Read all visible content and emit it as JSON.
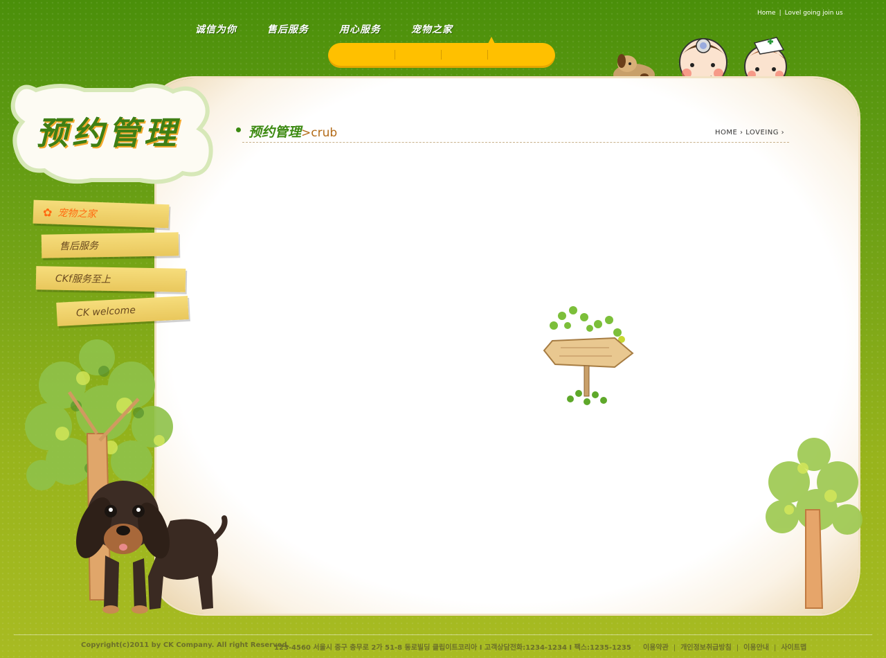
{
  "top_links": {
    "home": "Home",
    "separator": "|",
    "join": "Lovel going join us"
  },
  "top_nav": [
    "诚信为你",
    "售后服务",
    "用心服务",
    "宠物之家"
  ],
  "page": {
    "title": "预约管理",
    "heading": "预约管理",
    "heading_sub": ">crub",
    "breadcrumb": [
      "HOME",
      "LOVEING"
    ]
  },
  "side_nav": [
    {
      "label": "宠物之家",
      "active": true
    },
    {
      "label": "售后服务",
      "active": false
    },
    {
      "label": "CKf服务至上",
      "active": false
    },
    {
      "label": "CK welcome",
      "active": false
    }
  ],
  "footer": {
    "copyright": "Copyright(c)2011 by CK  Company. All right Reserved.",
    "address": "123-4560 서울시 중구 충무로 2가 51-8 동로빌딩 클립이트코리아  I  고객상담전화:1234-1234  I  팩스:1235-1235",
    "links": [
      "이용약관",
      "개인정보취급방침",
      "이용안내",
      "사이트맵"
    ]
  },
  "colors": {
    "green": "#4a8f0a",
    "accent": "#ffc000",
    "active": "#ff6a10"
  }
}
